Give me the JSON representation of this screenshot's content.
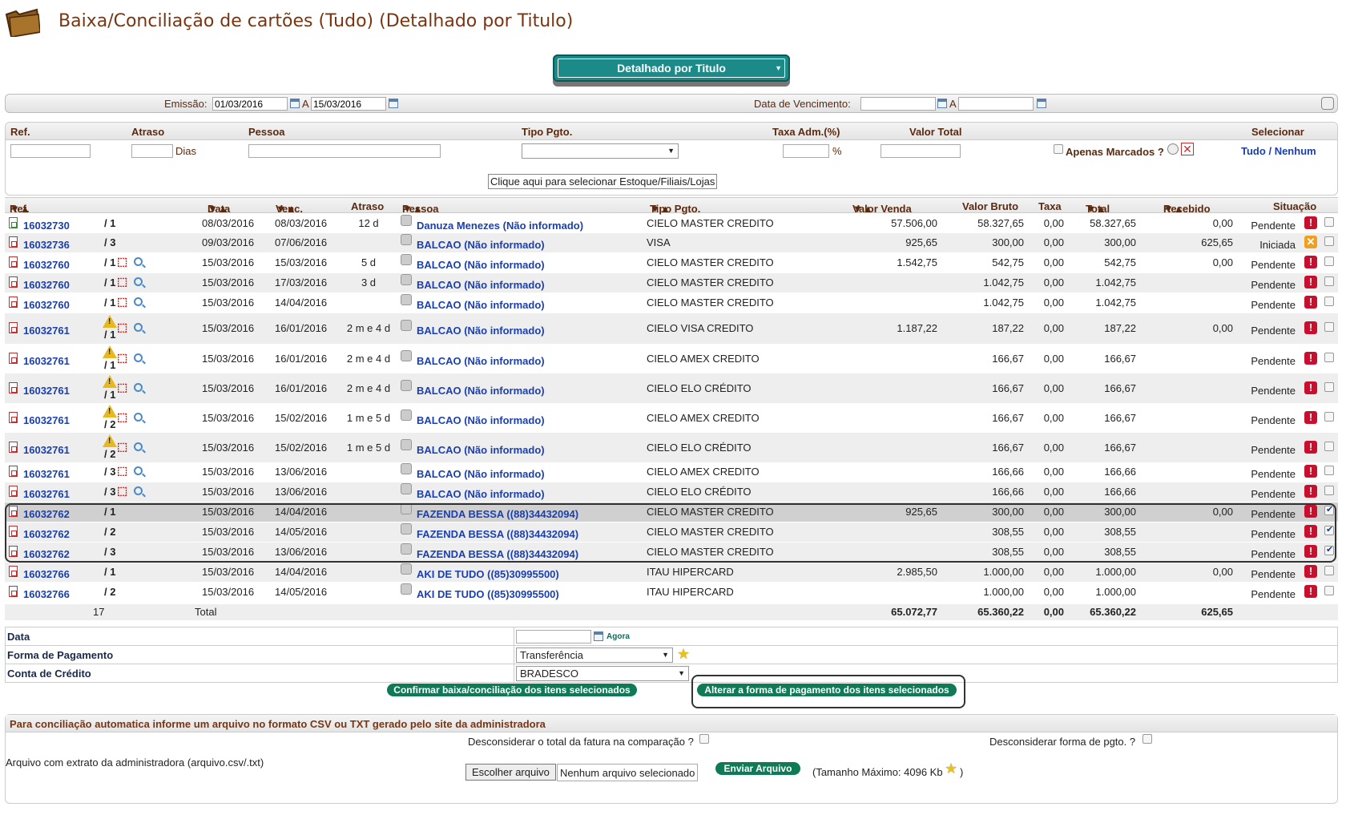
{
  "header": {
    "title": "Baixa/Conciliação de cartões (Tudo) (Detalhado por Titulo)",
    "view_select": "Detalhado por Titulo"
  },
  "dates": {
    "emissao_label": "Emissão:",
    "emissao_from": "01/03/2016",
    "a1": "A",
    "emissao_to": "15/03/2016",
    "venc_label": "Data de Vencimento:",
    "a2": "A",
    "venc_from": "",
    "venc_to": ""
  },
  "filters": {
    "h_ref": "Ref.",
    "h_atraso": "Atraso",
    "h_pessoa": "Pessoa",
    "h_tipo": "Tipo Pgto.",
    "h_taxa": "Taxa Adm.(%)",
    "h_valor": "Valor Total",
    "h_sel": "Selecionar",
    "dias": "Dias",
    "pct": "%",
    "apenas": "Apenas Marcados ?",
    "tudo": "Tudo",
    "slash": "/",
    "nenhum": "Nenhum",
    "estoque_btn": "Clique aqui para selecionar Estoque/Filiais/Lojas"
  },
  "table": {
    "headers": {
      "ref": "Ref.",
      "data": "Data",
      "venc": "Venc.",
      "atraso": "Atraso",
      "pessoa": "Pessoa",
      "tipo": "Tipo Pgto.",
      "venda": "Valor Venda",
      "bruto": "Valor Bruto",
      "taxa": "Taxa",
      "total": "Total",
      "recebido": "Recebido",
      "situacao": "Situação"
    },
    "rows": [
      {
        "ref": "16032730",
        "parc": "/ 1",
        "data": "08/03/2016",
        "venc": "08/03/2016",
        "atraso": "12 d",
        "pessoa": "Danuza Menezes (Não informado)",
        "tipo": "CIELO MASTER CREDITO",
        "venda": "57.506,00",
        "bruto": "58.327,65",
        "taxa": "0,00",
        "total": "58.327,65",
        "recebido": "0,00",
        "sit": "Pendente"
      },
      {
        "ref": "16032736",
        "parc": "/ 3",
        "data": "09/03/2016",
        "venc": "07/06/2016",
        "atraso": "",
        "pessoa": "BALCAO (Não informado)",
        "tipo": "VISA",
        "venda": "925,65",
        "bruto": "300,00",
        "taxa": "0,00",
        "total": "300,00",
        "recebido": "625,65",
        "sit": "Iniciada"
      },
      {
        "ref": "16032760",
        "parc": "/ 1",
        "data": "15/03/2016",
        "venc": "15/03/2016",
        "atraso": "5 d",
        "pessoa": "BALCAO (Não informado)",
        "tipo": "CIELO MASTER CREDITO",
        "venda": "1.542,75",
        "bruto": "542,75",
        "taxa": "0,00",
        "total": "542,75",
        "recebido": "0,00",
        "sit": "Pendente"
      },
      {
        "ref": "16032760",
        "parc": "/ 1",
        "data": "15/03/2016",
        "venc": "17/03/2016",
        "atraso": "3 d",
        "pessoa": "BALCAO (Não informado)",
        "tipo": "CIELO MASTER CREDITO",
        "venda": "",
        "bruto": "1.042,75",
        "taxa": "0,00",
        "total": "1.042,75",
        "recebido": "",
        "sit": "Pendente"
      },
      {
        "ref": "16032760",
        "parc": "/ 1",
        "data": "15/03/2016",
        "venc": "14/04/2016",
        "atraso": "",
        "pessoa": "BALCAO (Não informado)",
        "tipo": "CIELO MASTER CREDITO",
        "venda": "",
        "bruto": "1.042,75",
        "taxa": "0,00",
        "total": "1.042,75",
        "recebido": "",
        "sit": "Pendente"
      },
      {
        "ref": "16032761",
        "parc": "/ 1",
        "data": "15/03/2016",
        "venc": "16/01/2016",
        "atraso": "2 m e 4 d",
        "pessoa": "BALCAO (Não informado)",
        "tipo": "CIELO VISA CREDITO",
        "venda": "1.187,22",
        "bruto": "187,22",
        "taxa": "0,00",
        "total": "187,22",
        "recebido": "0,00",
        "sit": "Pendente"
      },
      {
        "ref": "16032761",
        "parc": "/ 1",
        "data": "15/03/2016",
        "venc": "16/01/2016",
        "atraso": "2 m e 4 d",
        "pessoa": "BALCAO (Não informado)",
        "tipo": "CIELO AMEX CREDITO",
        "venda": "",
        "bruto": "166,67",
        "taxa": "0,00",
        "total": "166,67",
        "recebido": "",
        "sit": "Pendente"
      },
      {
        "ref": "16032761",
        "parc": "/ 1",
        "data": "15/03/2016",
        "venc": "16/01/2016",
        "atraso": "2 m e 4 d",
        "pessoa": "BALCAO (Não informado)",
        "tipo": "CIELO ELO CRÉDITO",
        "venda": "",
        "bruto": "166,67",
        "taxa": "0,00",
        "total": "166,67",
        "recebido": "",
        "sit": "Pendente"
      },
      {
        "ref": "16032761",
        "parc": "/ 2",
        "data": "15/03/2016",
        "venc": "15/02/2016",
        "atraso": "1 m e 5 d",
        "pessoa": "BALCAO (Não informado)",
        "tipo": "CIELO AMEX CREDITO",
        "venda": "",
        "bruto": "166,67",
        "taxa": "0,00",
        "total": "166,67",
        "recebido": "",
        "sit": "Pendente"
      },
      {
        "ref": "16032761",
        "parc": "/ 2",
        "data": "15/03/2016",
        "venc": "15/02/2016",
        "atraso": "1 m e 5 d",
        "pessoa": "BALCAO (Não informado)",
        "tipo": "CIELO ELO CRÉDITO",
        "venda": "",
        "bruto": "166,67",
        "taxa": "0,00",
        "total": "166,67",
        "recebido": "",
        "sit": "Pendente"
      },
      {
        "ref": "16032761",
        "parc": "/ 3",
        "data": "15/03/2016",
        "venc": "13/06/2016",
        "atraso": "",
        "pessoa": "BALCAO (Não informado)",
        "tipo": "CIELO AMEX CREDITO",
        "venda": "",
        "bruto": "166,66",
        "taxa": "0,00",
        "total": "166,66",
        "recebido": "",
        "sit": "Pendente"
      },
      {
        "ref": "16032761",
        "parc": "/ 3",
        "data": "15/03/2016",
        "venc": "13/06/2016",
        "atraso": "",
        "pessoa": "BALCAO (Não informado)",
        "tipo": "CIELO ELO CRÉDITO",
        "venda": "",
        "bruto": "166,66",
        "taxa": "0,00",
        "total": "166,66",
        "recebido": "",
        "sit": "Pendente"
      },
      {
        "ref": "16032762",
        "parc": "/ 1",
        "data": "15/03/2016",
        "venc": "14/04/2016",
        "atraso": "",
        "pessoa": "FAZENDA BESSA ((88)34432094)",
        "tipo": "CIELO MASTER CREDITO",
        "venda": "925,65",
        "bruto": "300,00",
        "taxa": "0,00",
        "total": "300,00",
        "recebido": "0,00",
        "sit": "Pendente"
      },
      {
        "ref": "16032762",
        "parc": "/ 2",
        "data": "15/03/2016",
        "venc": "14/05/2016",
        "atraso": "",
        "pessoa": "FAZENDA BESSA ((88)34432094)",
        "tipo": "CIELO MASTER CREDITO",
        "venda": "",
        "bruto": "308,55",
        "taxa": "0,00",
        "total": "308,55",
        "recebido": "",
        "sit": "Pendente"
      },
      {
        "ref": "16032762",
        "parc": "/ 3",
        "data": "15/03/2016",
        "venc": "13/06/2016",
        "atraso": "",
        "pessoa": "FAZENDA BESSA ((88)34432094)",
        "tipo": "CIELO MASTER CREDITO",
        "venda": "",
        "bruto": "308,55",
        "taxa": "0,00",
        "total": "308,55",
        "recebido": "",
        "sit": "Pendente"
      },
      {
        "ref": "16032766",
        "parc": "/ 1",
        "data": "15/03/2016",
        "venc": "14/04/2016",
        "atraso": "",
        "pessoa": "AKI DE TUDO ((85)30995500)",
        "tipo": "ITAU HIPERCARD",
        "venda": "2.985,50",
        "bruto": "1.000,00",
        "taxa": "0,00",
        "total": "1.000,00",
        "recebido": "0,00",
        "sit": "Pendente"
      },
      {
        "ref": "16032766",
        "parc": "/ 2",
        "data": "15/03/2016",
        "venc": "14/05/2016",
        "atraso": "",
        "pessoa": "AKI DE TUDO ((85)30995500)",
        "tipo": "ITAU HIPERCARD",
        "venda": "",
        "bruto": "1.000,00",
        "taxa": "0,00",
        "total": "1.000,00",
        "recebido": "",
        "sit": "Pendente"
      }
    ],
    "totals": {
      "count": "17",
      "label": "Total",
      "venda": "65.072,77",
      "bruto": "65.360,22",
      "taxa": "0,00",
      "total": "65.360,22",
      "recebido": "625,65"
    }
  },
  "form": {
    "data_label": "Data",
    "agora": "Agora",
    "forma_label": "Forma de Pagamento",
    "forma_value": "Transferência",
    "conta_label": "Conta de Crédito",
    "conta_value": "BRADESCO",
    "confirm_btn": "Confirmar baixa/conciliação dos itens selecionados",
    "alterar_btn": "Alterar a forma de pagamento dos itens selecionados"
  },
  "import": {
    "title": "Para conciliação automatica informe um arquivo no formato CSV ou TXT gerado pelo site da administradora",
    "desc_total": "Desconsiderar o total da fatura na comparação ?",
    "desc_forma": "Desconsiderar forma de pgto. ?",
    "arquivo_label": "Arquivo com extrato da administradora (arquivo.csv/.txt)",
    "choose_btn": "Escolher arquivo",
    "no_file": "Nenhum arquivo selecionado",
    "send_btn": "Enviar Arquivo",
    "max": "(Tamanho Máximo: 4096 Kb",
    "max_close": ")"
  }
}
